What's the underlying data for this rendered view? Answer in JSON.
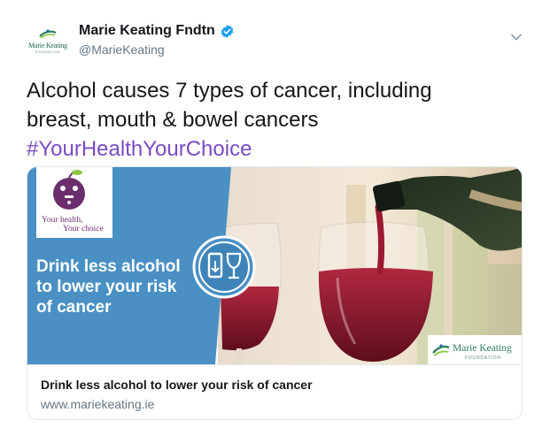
{
  "author": {
    "display_name": "Marie Keating Fndtn",
    "handle": "@MarieKeating",
    "avatar_text": "Marie Keating",
    "avatar_subtext": "FOUNDATION",
    "verified": true
  },
  "tweet": {
    "text_line1": "Alcohol causes 7 types of cancer, including",
    "text_line2": "breast, mouth & bowel cancers",
    "hashtag": "#YourHealthYourChoice"
  },
  "card": {
    "badge_line1": "Your health,",
    "badge_line2": "Your choice",
    "headline_line1": "Drink less alcohol",
    "headline_line2": "to lower your risk",
    "headline_line3": "of cancer",
    "logo_text": "Marie Keating",
    "logo_subtext": "FOUNDATION",
    "title": "Drink less alcohol to lower your risk of cancer",
    "domain": "www.mariekeating.ie"
  },
  "icons": [
    "verified-icon",
    "chevron-down-icon",
    "glasses-icon",
    "wine-bottle",
    "apple-icon"
  ],
  "colors": {
    "brand_blue": "#4a90c4",
    "hashtag": "#794bc4",
    "secondary_text": "#657786",
    "verified": "#1da1f2",
    "wine": "#8b1a2b",
    "logo_green": "#2e7d5b",
    "badge_purple": "#6b2d6e"
  }
}
